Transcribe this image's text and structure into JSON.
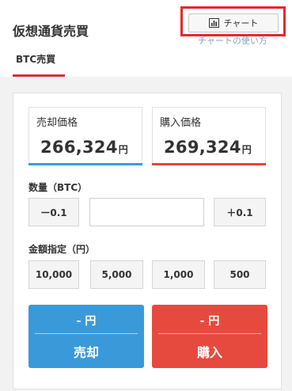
{
  "header": {
    "title": "仮想通貨売買",
    "chart_button_label": "チャート",
    "chart_help_link": "チャートの使い方",
    "tab_label": "BTC売買"
  },
  "prices": {
    "sell": {
      "label": "売却価格",
      "value": "266,324",
      "unit": "円"
    },
    "buy": {
      "label": "購入価格",
      "value": "269,324",
      "unit": "円"
    }
  },
  "quantity": {
    "label": "数量（BTC）",
    "minus_label": "ー0.1",
    "plus_label": "＋0.1",
    "value": ""
  },
  "amount": {
    "label": "金額指定（円）",
    "options": [
      "10,000",
      "5,000",
      "1,000",
      "500"
    ]
  },
  "actions": {
    "sell": {
      "amount": "- 円",
      "label": "売却"
    },
    "buy": {
      "amount": "- 円",
      "label": "購入"
    }
  },
  "colors": {
    "sell": "#3a9ad9",
    "buy": "#e64a3e",
    "highlight": "#e8272c",
    "tab_underline": "#d0343a"
  },
  "icons": {
    "chart_button": "bar-chart-icon"
  }
}
